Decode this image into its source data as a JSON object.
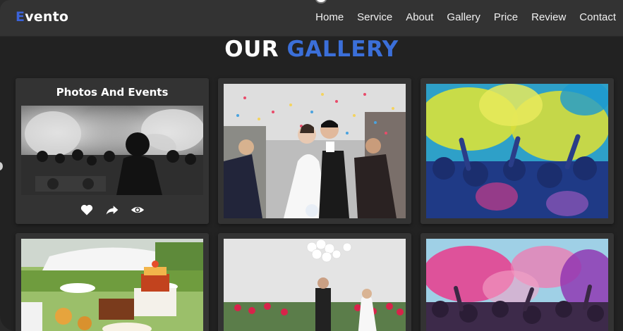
{
  "brand": {
    "first_letter": "E",
    "rest": "vento"
  },
  "nav": {
    "items": [
      "Home",
      "Service",
      "About",
      "Gallery",
      "Price",
      "Review",
      "Contact"
    ]
  },
  "section": {
    "title_part1": "OUR",
    "title_part2": "GALLERY"
  },
  "gallery": {
    "featured_title": "Photos And Events",
    "featured_icons": [
      "heart-icon",
      "share-icon",
      "eye-icon"
    ]
  },
  "colors": {
    "accent": "#3b6fd9",
    "background": "#222222",
    "card": "#333333"
  }
}
